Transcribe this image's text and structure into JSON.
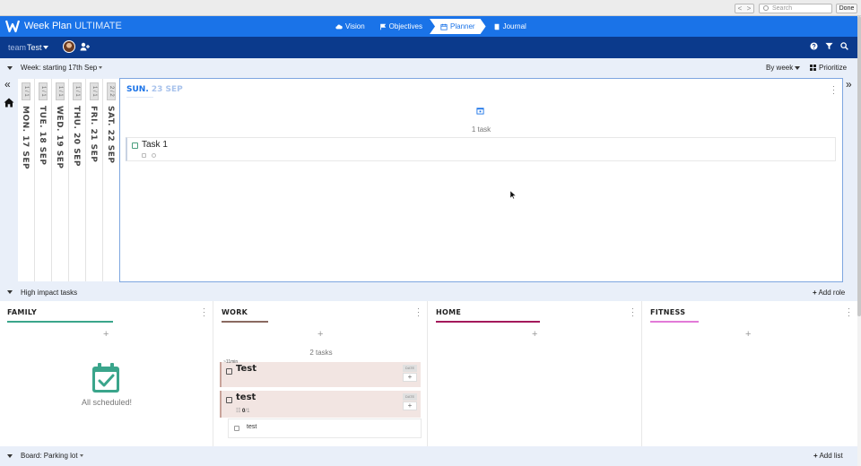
{
  "browser": {
    "search_placeholder": "Search",
    "done_label": "Done",
    "back": "<",
    "forward": ">"
  },
  "header": {
    "brand_name": "Week Plan",
    "brand_edition": "ULTIMATE",
    "tabs": [
      {
        "label": "Vision",
        "icon": "cloud-icon"
      },
      {
        "label": "Objectives",
        "icon": "flag-icon"
      },
      {
        "label": "Planner",
        "icon": "calendar-icon",
        "active": true
      },
      {
        "label": "Journal",
        "icon": "book-icon"
      }
    ],
    "accent_color": "#1a73e8",
    "subbar_color": "#0b3a8c"
  },
  "team": {
    "label": "team",
    "name": "Test"
  },
  "week": {
    "label": "Week: starting 17th Sep",
    "view_label": "By week",
    "prioritize_label": "Prioritize",
    "days": [
      {
        "count": "1 / 1",
        "name": "MON. 17 SEP"
      },
      {
        "count": "1 / 1",
        "name": "TUE. 18 SEP"
      },
      {
        "count": "1 / 1",
        "name": "WED. 19 SEP"
      },
      {
        "count": "1 / 1",
        "name": "THU. 20 SEP"
      },
      {
        "count": "1 / 1",
        "name": "FRI. 21 SEP"
      },
      {
        "count": "2 / 2",
        "name": "SAT. 22 SEP"
      }
    ],
    "selected_day": {
      "day": "SUN.",
      "date": "23 SEP",
      "tasks_count": "1 task",
      "tasks": [
        {
          "title": "Task 1"
        }
      ]
    },
    "prev_arrow": "«",
    "next_arrow": "»"
  },
  "high_impact": {
    "label": "High impact tasks",
    "add_role_label": "Add role"
  },
  "roles": [
    {
      "name": "FAMILY",
      "color": "#3aa58b",
      "empty_text": "All scheduled!"
    },
    {
      "name": "WORK",
      "color": "#8a6a60",
      "tasks_count": "2 tasks",
      "tasks": [
        {
          "title": "Test",
          "duration": "~11min",
          "date_label": "DATE"
        },
        {
          "title": "test",
          "date_label": "DATE",
          "progress": "0",
          "progress_total": "1"
        }
      ],
      "subtask": "test"
    },
    {
      "name": "HOME",
      "color": "#a3195b"
    },
    {
      "name": "FITNESS",
      "color": "#e27ad8"
    }
  ],
  "board": {
    "label": "Board: Parking lot",
    "add_list_label": "Add list"
  }
}
